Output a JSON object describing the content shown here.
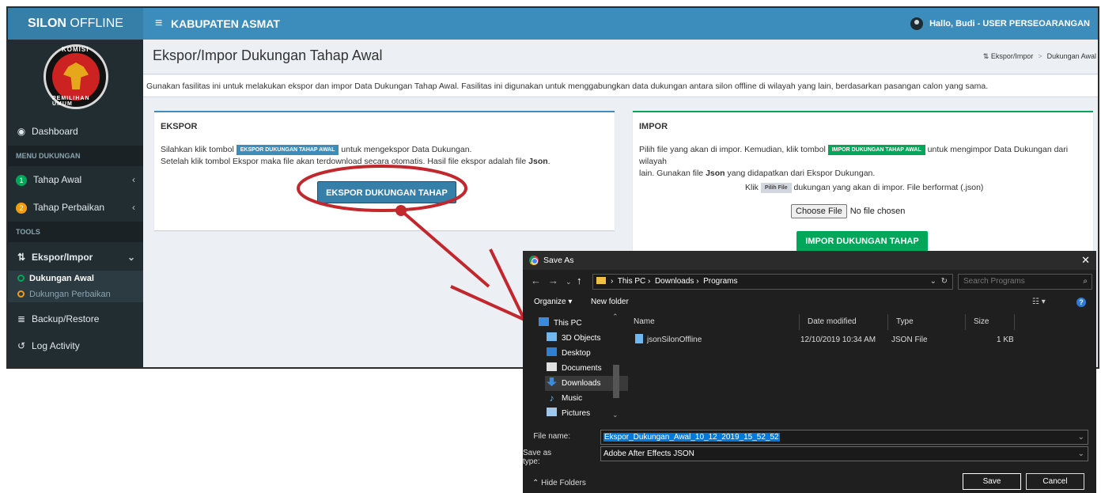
{
  "topbar": {
    "brand_bold": "SILON",
    "brand_rest": " OFFLINE",
    "menu_icon": "≡",
    "region": "KABUPATEN ASMAT",
    "user_greeting": "Hallo, Budi - USER PERSEOARANGAN"
  },
  "logo": {
    "top_text": "KOMISI",
    "bottom_text": "PEMILIHAN UMUM"
  },
  "sidebar": {
    "dashboard": "Dashboard",
    "menu_header": "MENU DUKUNGAN",
    "tahap_awal": "Tahap Awal",
    "tahap_awal_num": "1",
    "tahap_perbaikan": "Tahap Perbaikan",
    "tahap_perbaikan_num": "2",
    "tools_header": "TOOLS",
    "ekspor_impor": "Ekspor/Impor",
    "sub_awal": "Dukungan Awal",
    "sub_perbaikan": "Dukungan Perbaikan",
    "backup": "Backup/Restore",
    "log": "Log Activity"
  },
  "page": {
    "title": "Ekspor/Impor Dukungan Tahap Awal",
    "crumb_root": "Ekspor/Impor",
    "crumb_sep": ">",
    "crumb_current": "Dukungan Awal",
    "info": "Gunakan fasilitas ini untuk melakukan ekspor dan impor Data Dukungan Tahap Awal. Fasilitas ini digunakan untuk menggabungkan data dukungan antara silon offline di wilayah yang lain, berdasarkan pasangan calon yang sama."
  },
  "ekspor": {
    "title": "EKSPOR",
    "line1_a": "Silahkan klik tombol ",
    "line1_chip": "EKSPOR DUKUNGAN TAHAP AWAL",
    "line1_b": " untuk mengekspor Data Dukungan.",
    "line2_a": "Setelah klik tombol Ekspor maka file akan terdownload secara otomatis. Hasil file ekspor adalah file ",
    "line2_bold": "Json",
    "line2_b": ".",
    "button": "EKSPOR DUKUNGAN TAHAP AWAL"
  },
  "impor": {
    "title": "IMPOR",
    "line1_a": "Pilih file yang akan di impor. Kemudian, klik tombol ",
    "line1_chip": "IMPOR DUKUNGAN TAHAP AWAL",
    "line1_b": " untuk mengimpor Data Dukungan dari wilayah",
    "line2_a": "lain. Gunakan file ",
    "line2_bold": "Json",
    "line2_b": " yang didapatkan dari Ekspor Dukungan.",
    "line3_a": "Klik ",
    "line3_chip": "Pilih File",
    "line3_b": " dukungan yang akan di impor. File berformat (.json)",
    "choose_button": "Choose File",
    "no_file": "No file chosen",
    "button": "IMPOR DUKUNGAN TAHAP AWAL"
  },
  "dialog": {
    "title": "Save As",
    "close": "✕",
    "path_root": "This PC",
    "path_1": "Downloads",
    "path_2": "Programs",
    "search_placeholder": "Search Programs",
    "organize": "Organize ▾",
    "new_folder": "New folder",
    "nav_items": [
      "This PC",
      "3D Objects",
      "Desktop",
      "Documents",
      "Downloads",
      "Music",
      "Pictures"
    ],
    "columns": {
      "name": "Name",
      "date": "Date modified",
      "type": "Type",
      "size": "Size"
    },
    "file": {
      "name": "jsonSilonOffline",
      "date": "12/10/2019 10:34 AM",
      "type": "JSON File",
      "size": "1 KB"
    },
    "file_name_label": "File name:",
    "file_name_value": "Ekspor_Dukungan_Awal_10_12_2019_15_52_52",
    "save_type_label": "Save as type:",
    "save_type_value": "Adobe After Effects JSON",
    "hide_folders": "Hide Folders",
    "save": "Save",
    "cancel": "Cancel"
  },
  "colors": {
    "primary": "#3c8dbc",
    "success": "#00a65a",
    "sidebar": "#222d32",
    "annotation": "#c1272d"
  }
}
